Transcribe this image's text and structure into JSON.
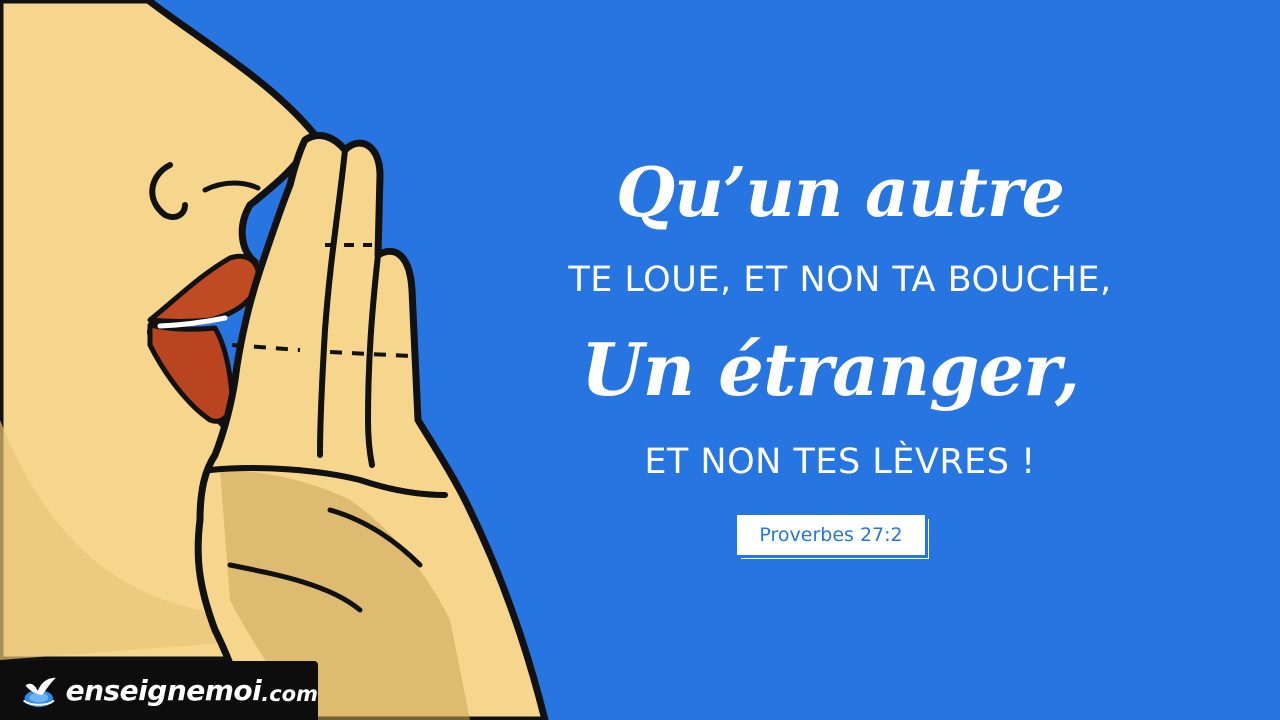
{
  "quote": {
    "line1": "Qu’un autre",
    "line2": "TE LOUE, ET NON TA BOUCHE,",
    "line3": "Un étranger,",
    "line4": "ET NON TES LÈVRES !"
  },
  "reference": "Proverbes 27:2",
  "brand": {
    "name": "enseignemoi",
    "tld": ".com"
  },
  "colors": {
    "background": "#2775e0",
    "skin": "#f5d68c",
    "skin_shadow": "#c9a65a",
    "lips": "#c04a22",
    "outline": "#111111",
    "text": "#ffffff"
  },
  "icons": [
    "dove-globe-icon"
  ]
}
